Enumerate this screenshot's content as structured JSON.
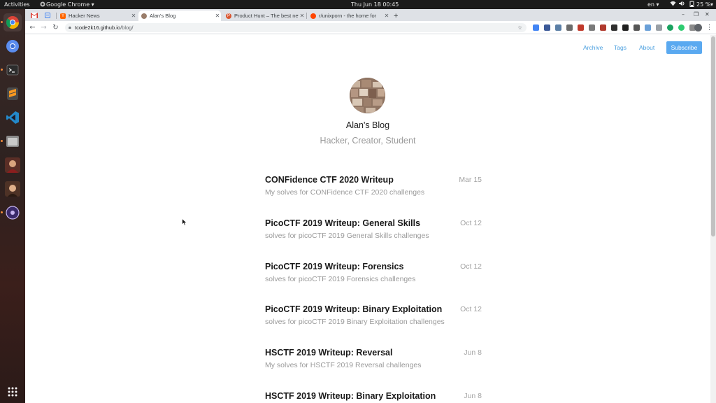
{
  "system": {
    "activities": "Activities",
    "app_menu": "Google Chrome ▾",
    "clock": "Thu Jun 18  00:45",
    "lang": "en ▾",
    "battery": "25 %"
  },
  "tabs": [
    {
      "label": "",
      "icon": "gmail-icon",
      "color": "#d93025"
    },
    {
      "label": "",
      "icon": "docs-icon",
      "color": "#4285f4"
    },
    {
      "label": "Hacker News",
      "icon": "hn-icon",
      "color": "#ff6600"
    },
    {
      "label": "Alan's Blog",
      "icon": "blog-favicon-icon",
      "color": "#9a7d6a"
    },
    {
      "label": "Product Hunt – The best new",
      "icon": "product-hunt-icon",
      "color": "#da552f"
    },
    {
      "label": "r/unixporn - the home for",
      "icon": "reddit-icon",
      "color": "#ff4500"
    }
  ],
  "new_tab": "+",
  "address": {
    "host": "tcode2k16.github.io",
    "path": "/blog/"
  },
  "blog": {
    "nav": [
      "Archive",
      "Tags",
      "About"
    ],
    "subscribe": "Subscribe",
    "title": "Alan's Blog",
    "subtitle": "Hacker, Creator, Student",
    "posts": [
      {
        "title": "CONFidence CTF 2020 Writeup",
        "date": "Mar 15",
        "desc": "My solves for CONFidence CTF 2020 challenges"
      },
      {
        "title": "PicoCTF 2019 Writeup: General Skills",
        "date": "Oct 12",
        "desc": "solves for picoCTF 2019 General Skills challenges"
      },
      {
        "title": "PicoCTF 2019 Writeup: Forensics",
        "date": "Oct 12",
        "desc": "solves for picoCTF 2019 Forensics challenges"
      },
      {
        "title": "PicoCTF 2019 Writeup: Binary Exploitation",
        "date": "Oct 12",
        "desc": "solves for picoCTF 2019 Binary Exploitation challenges"
      },
      {
        "title": "HSCTF 2019 Writeup: Reversal",
        "date": "Jun 8",
        "desc": "My solves for HSCTF 2019 Reversal challenges"
      },
      {
        "title": "HSCTF 2019 Writeup: Binary Exploitation",
        "date": "Jun 8",
        "desc": ""
      }
    ]
  },
  "colors": {
    "link": "#4a9fdf",
    "subscribe_bg": "#5aa9f0"
  }
}
